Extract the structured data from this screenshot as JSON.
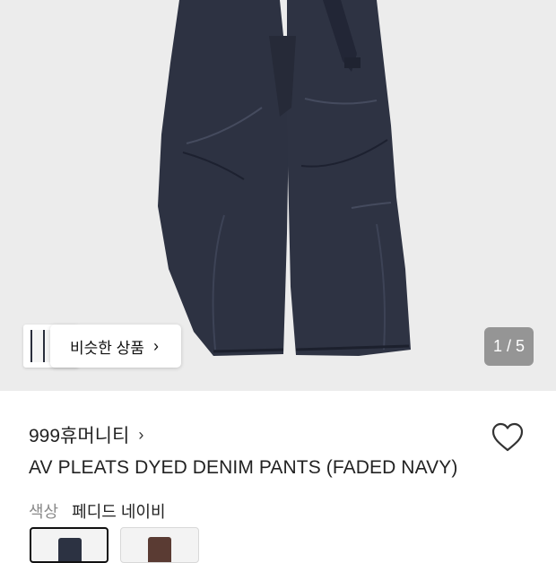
{
  "gallery": {
    "similar_button_label": "비슷한 상품",
    "similar_button_icon": "chevron-right-icon",
    "page_current": "1",
    "page_separator": "/",
    "page_total": "5",
    "page_counter_text": "1 / 5"
  },
  "product": {
    "brand": "999휴머니티",
    "brand_chevron_icon": "chevron-right-icon",
    "wishlist_icon": "heart-outline-icon",
    "title": "AV PLEATS DYED DENIM PANTS (FADED NAVY)"
  },
  "color_option": {
    "label": "색상",
    "selected_value": "페디드 네이비",
    "swatches": [
      {
        "color": "#2c3242",
        "selected": true
      },
      {
        "color": "#5a3b33",
        "selected": false
      }
    ]
  },
  "colors": {
    "hero_background": "#ececec",
    "denim": "#2d3242",
    "denim_dark": "#1f2331",
    "badge_background": "#7f7f7f"
  }
}
